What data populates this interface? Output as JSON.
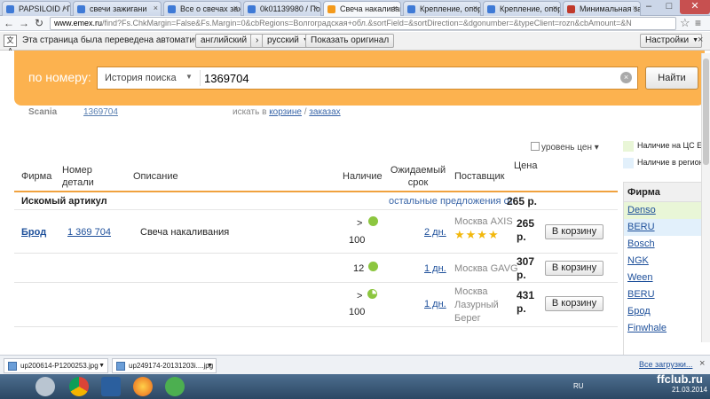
{
  "browser": {
    "tabs": [
      {
        "label": "PAPSILOID / Про",
        "favicon": "#3f7ad6"
      },
      {
        "label": "свечи зажигани",
        "favicon": "#3f7ad6"
      },
      {
        "label": "Все о свечах заж",
        "favicon": "#3f7ad6"
      },
      {
        "label": "0k01139980 / Пои",
        "favicon": "#3f7ad6"
      },
      {
        "label": "Свеча накаливан",
        "favicon": "#f39a1c"
      },
      {
        "label": "Крепление, опор",
        "favicon": "#3f7ad6"
      },
      {
        "label": "Крепление, опор",
        "favicon": "#3f7ad6"
      },
      {
        "label": "Минимальная за",
        "favicon": "#c0392b"
      }
    ],
    "url_domain": "www.emex.ru",
    "url_path": "/find?Fs.ChkMargin=False&Fs.Margin=0&cbRegions=Волгоградская+обл.&sortField=&sortDirection=&dgonumber=&typeClient=rozn&cbAmount=&N",
    "window_controls": {
      "minimize": "–",
      "maximize": "□",
      "close": "✕"
    }
  },
  "translate_bar": {
    "message": "Эта страница была переведена автоматически",
    "from_lang": "английский",
    "to_lang": "русский",
    "show_original": "Показать оригинал",
    "settings": "Настройки"
  },
  "search": {
    "label": "по номеру:",
    "history": "История поиска",
    "value": "1369704",
    "find_button": "Найти"
  },
  "previous_row": {
    "brand": "Scania",
    "number": "1369704",
    "seek_prefix": "искать в",
    "cart_link": "корзине",
    "slash": "/",
    "orders_link": "заказах"
  },
  "price_level": "уровень цен",
  "table": {
    "headers": {
      "firm": "Фирма",
      "part_number": "Номер детали",
      "description": "Описание",
      "availability": "Наличие",
      "expected": "Ожидаемый срок",
      "supplier": "Поставщик",
      "price": "Цена"
    },
    "group": {
      "title": "Искомый артикул",
      "other_offers": "остальные предложения от",
      "other_price": "265 р."
    },
    "item": {
      "firm": "Брод",
      "number": "1 369 704",
      "description": "Свеча накаливания"
    },
    "offers": [
      {
        "avail_prefix": ">",
        "avail": "100",
        "term": "2 дн.",
        "supplier": "Москва AXIS",
        "rating": 4,
        "price": "265 р.",
        "button": "В корзину"
      },
      {
        "avail_prefix": "",
        "avail": "12",
        "term": "1 дн.",
        "supplier": "Москва GAVG",
        "rating": 0,
        "price": "307 р.",
        "button": "В корзину"
      },
      {
        "avail_prefix": ">",
        "avail": "100",
        "term": "1 дн.",
        "supplier": "Москва Лазурный Берег",
        "rating": 0,
        "price": "431 р.",
        "button": "В корзину"
      }
    ],
    "star_glyphs": "★★★★"
  },
  "legend": [
    {
      "label": "Наличие на ЦС Em",
      "color": "#e9f6d7"
    },
    {
      "label": "Наличие в регионе",
      "color": "#e2f0fb"
    }
  ],
  "filter": {
    "title": "Фирма",
    "items": [
      {
        "label": "Denso",
        "style": "green"
      },
      {
        "label": "BERU",
        "style": "blue"
      },
      {
        "label": "Bosch",
        "style": ""
      },
      {
        "label": "NGK",
        "style": ""
      },
      {
        "label": "Ween",
        "style": ""
      },
      {
        "label": "BERU",
        "style": ""
      },
      {
        "label": "Брод",
        "style": ""
      },
      {
        "label": "Finwhale",
        "style": ""
      }
    ]
  },
  "downloads": {
    "items": [
      "up200614-P1200253.jpg",
      "up249174-20131203i....jpg"
    ],
    "show_all": "Все загрузки..."
  },
  "taskbar": {
    "lang": "RU",
    "date": "21.03.2014",
    "watermark": "ffclub.ru"
  }
}
